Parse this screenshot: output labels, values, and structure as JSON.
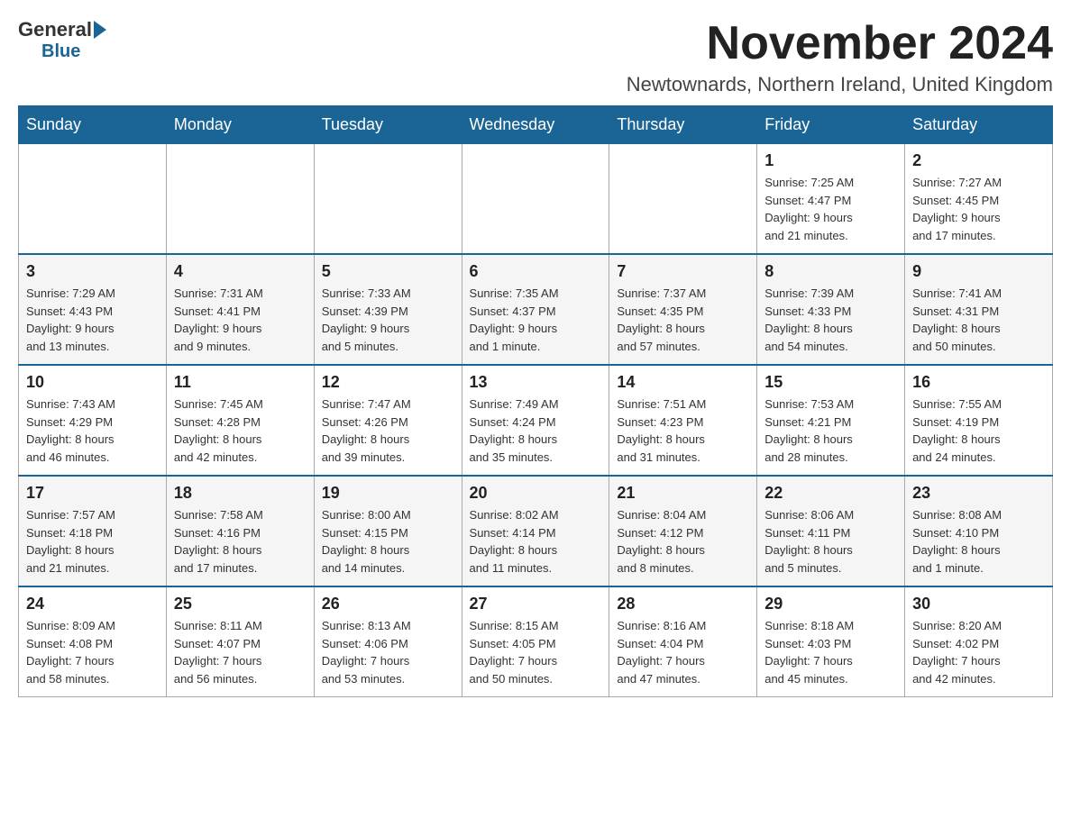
{
  "header": {
    "logo": {
      "general": "General",
      "blue": "Blue"
    },
    "title": "November 2024",
    "location": "Newtownards, Northern Ireland, United Kingdom"
  },
  "weekdays": [
    "Sunday",
    "Monday",
    "Tuesday",
    "Wednesday",
    "Thursday",
    "Friday",
    "Saturday"
  ],
  "weeks": [
    [
      {
        "day": "",
        "info": ""
      },
      {
        "day": "",
        "info": ""
      },
      {
        "day": "",
        "info": ""
      },
      {
        "day": "",
        "info": ""
      },
      {
        "day": "",
        "info": ""
      },
      {
        "day": "1",
        "info": "Sunrise: 7:25 AM\nSunset: 4:47 PM\nDaylight: 9 hours\nand 21 minutes."
      },
      {
        "day": "2",
        "info": "Sunrise: 7:27 AM\nSunset: 4:45 PM\nDaylight: 9 hours\nand 17 minutes."
      }
    ],
    [
      {
        "day": "3",
        "info": "Sunrise: 7:29 AM\nSunset: 4:43 PM\nDaylight: 9 hours\nand 13 minutes."
      },
      {
        "day": "4",
        "info": "Sunrise: 7:31 AM\nSunset: 4:41 PM\nDaylight: 9 hours\nand 9 minutes."
      },
      {
        "day": "5",
        "info": "Sunrise: 7:33 AM\nSunset: 4:39 PM\nDaylight: 9 hours\nand 5 minutes."
      },
      {
        "day": "6",
        "info": "Sunrise: 7:35 AM\nSunset: 4:37 PM\nDaylight: 9 hours\nand 1 minute."
      },
      {
        "day": "7",
        "info": "Sunrise: 7:37 AM\nSunset: 4:35 PM\nDaylight: 8 hours\nand 57 minutes."
      },
      {
        "day": "8",
        "info": "Sunrise: 7:39 AM\nSunset: 4:33 PM\nDaylight: 8 hours\nand 54 minutes."
      },
      {
        "day": "9",
        "info": "Sunrise: 7:41 AM\nSunset: 4:31 PM\nDaylight: 8 hours\nand 50 minutes."
      }
    ],
    [
      {
        "day": "10",
        "info": "Sunrise: 7:43 AM\nSunset: 4:29 PM\nDaylight: 8 hours\nand 46 minutes."
      },
      {
        "day": "11",
        "info": "Sunrise: 7:45 AM\nSunset: 4:28 PM\nDaylight: 8 hours\nand 42 minutes."
      },
      {
        "day": "12",
        "info": "Sunrise: 7:47 AM\nSunset: 4:26 PM\nDaylight: 8 hours\nand 39 minutes."
      },
      {
        "day": "13",
        "info": "Sunrise: 7:49 AM\nSunset: 4:24 PM\nDaylight: 8 hours\nand 35 minutes."
      },
      {
        "day": "14",
        "info": "Sunrise: 7:51 AM\nSunset: 4:23 PM\nDaylight: 8 hours\nand 31 minutes."
      },
      {
        "day": "15",
        "info": "Sunrise: 7:53 AM\nSunset: 4:21 PM\nDaylight: 8 hours\nand 28 minutes."
      },
      {
        "day": "16",
        "info": "Sunrise: 7:55 AM\nSunset: 4:19 PM\nDaylight: 8 hours\nand 24 minutes."
      }
    ],
    [
      {
        "day": "17",
        "info": "Sunrise: 7:57 AM\nSunset: 4:18 PM\nDaylight: 8 hours\nand 21 minutes."
      },
      {
        "day": "18",
        "info": "Sunrise: 7:58 AM\nSunset: 4:16 PM\nDaylight: 8 hours\nand 17 minutes."
      },
      {
        "day": "19",
        "info": "Sunrise: 8:00 AM\nSunset: 4:15 PM\nDaylight: 8 hours\nand 14 minutes."
      },
      {
        "day": "20",
        "info": "Sunrise: 8:02 AM\nSunset: 4:14 PM\nDaylight: 8 hours\nand 11 minutes."
      },
      {
        "day": "21",
        "info": "Sunrise: 8:04 AM\nSunset: 4:12 PM\nDaylight: 8 hours\nand 8 minutes."
      },
      {
        "day": "22",
        "info": "Sunrise: 8:06 AM\nSunset: 4:11 PM\nDaylight: 8 hours\nand 5 minutes."
      },
      {
        "day": "23",
        "info": "Sunrise: 8:08 AM\nSunset: 4:10 PM\nDaylight: 8 hours\nand 1 minute."
      }
    ],
    [
      {
        "day": "24",
        "info": "Sunrise: 8:09 AM\nSunset: 4:08 PM\nDaylight: 7 hours\nand 58 minutes."
      },
      {
        "day": "25",
        "info": "Sunrise: 8:11 AM\nSunset: 4:07 PM\nDaylight: 7 hours\nand 56 minutes."
      },
      {
        "day": "26",
        "info": "Sunrise: 8:13 AM\nSunset: 4:06 PM\nDaylight: 7 hours\nand 53 minutes."
      },
      {
        "day": "27",
        "info": "Sunrise: 8:15 AM\nSunset: 4:05 PM\nDaylight: 7 hours\nand 50 minutes."
      },
      {
        "day": "28",
        "info": "Sunrise: 8:16 AM\nSunset: 4:04 PM\nDaylight: 7 hours\nand 47 minutes."
      },
      {
        "day": "29",
        "info": "Sunrise: 8:18 AM\nSunset: 4:03 PM\nDaylight: 7 hours\nand 45 minutes."
      },
      {
        "day": "30",
        "info": "Sunrise: 8:20 AM\nSunset: 4:02 PM\nDaylight: 7 hours\nand 42 minutes."
      }
    ]
  ]
}
